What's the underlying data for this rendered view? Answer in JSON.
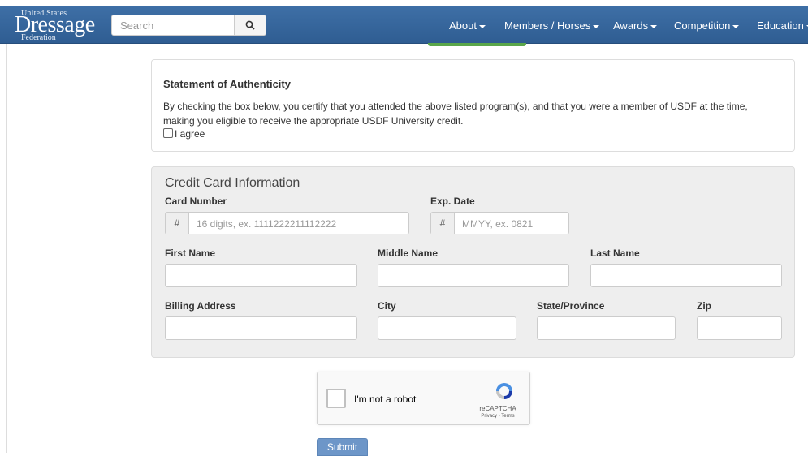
{
  "nav": {
    "logo": {
      "line1": "United States",
      "line2": "Dressage",
      "line3": "Federation"
    },
    "search_placeholder": "Search",
    "menu": [
      {
        "label": "About"
      },
      {
        "label": "Members / Horses"
      },
      {
        "label": "Awards"
      },
      {
        "label": "Competition"
      },
      {
        "label": "Education"
      }
    ]
  },
  "authenticity": {
    "title": "Statement of Authenticity",
    "text": "By checking the box below, you certify that you attended the above listed program(s), and that you were a member of USDF at the time, making you eligible to receive the appropriate USDF University credit.",
    "checkbox_label": "I agree"
  },
  "credit_card": {
    "title": "Credit Card Information",
    "card_number_label": "Card Number",
    "card_number_addon": "#",
    "card_number_placeholder": "16 digits, ex. 1111222211112222",
    "exp_label": "Exp. Date",
    "exp_addon": "#",
    "exp_placeholder": "MMYY, ex. 0821",
    "first_name_label": "First Name",
    "middle_name_label": "Middle Name",
    "last_name_label": "Last Name",
    "address_label": "Billing Address",
    "city_label": "City",
    "state_label": "State/Province",
    "zip_label": "Zip"
  },
  "captcha": {
    "label": "I'm not a robot",
    "brand": "reCAPTCHA",
    "links": "Privacy - Terms"
  },
  "submit_label": "Submit",
  "colors": {
    "nav": "#3e6fa6",
    "submit": "#6d96c8",
    "panel": "#eeeeee"
  }
}
